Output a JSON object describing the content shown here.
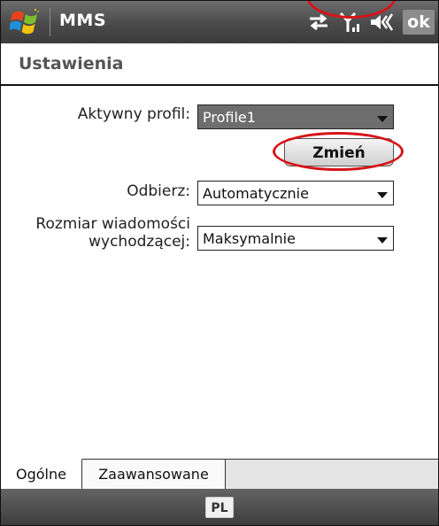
{
  "titlebar": {
    "app_title": "MMS",
    "ok_label": "ok",
    "icons": [
      "windows-start-logo",
      "connectivity-icon",
      "signal-strength-icon",
      "volume-icon"
    ]
  },
  "page": {
    "heading": "Ustawienia"
  },
  "form": {
    "active_profile": {
      "label": "Aktywny profil:",
      "value": "Profile1"
    },
    "change_button": "Zmień",
    "receive": {
      "label": "Odbierz:",
      "value": "Automatycznie"
    },
    "outgoing_size": {
      "label_line1": "Rozmiar wiadomości",
      "label_line2": "wychodzącej:",
      "value": "Maksymalnie"
    }
  },
  "tabs": [
    {
      "label": "Ogólne",
      "active": true
    },
    {
      "label": "Zaawansowane",
      "active": false
    }
  ],
  "bottombar": {
    "input_panel_label": "PL"
  },
  "colors": {
    "highlight_ring": "#d61418",
    "titlebar": "#4a4a4a",
    "selected_field": "#6e6e6e"
  }
}
